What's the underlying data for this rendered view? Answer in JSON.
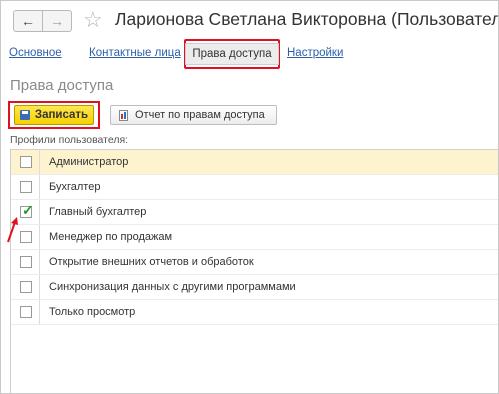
{
  "window": {
    "title": "Ларионова Светлана Викторовна (Пользователь)"
  },
  "nav": {
    "back_icon": "arrow-left-icon",
    "forward_icon": "arrow-right-icon",
    "favorite_icon": "star-icon"
  },
  "tabs": [
    {
      "label": "Основное"
    },
    {
      "label": "Контактные лица"
    },
    {
      "label": "Права доступа",
      "active": true
    },
    {
      "label": "Настройки"
    }
  ],
  "section_title": "Права доступа",
  "toolbar": {
    "save_label": "Записать",
    "report_label": "Отчет по правам доступа"
  },
  "profiles_label": "Профили пользователя:",
  "profiles": [
    {
      "label": "Администратор",
      "checked": false,
      "selected": true
    },
    {
      "label": "Бухгалтер",
      "checked": false
    },
    {
      "label": "Главный бухгалтер",
      "checked": true
    },
    {
      "label": "Менеджер по продажам",
      "checked": false
    },
    {
      "label": "Открытие внешних отчетов и обработок",
      "checked": false
    },
    {
      "label": "Синхронизация данных с другими программами",
      "checked": false
    },
    {
      "label": "Только просмотр",
      "checked": false
    }
  ],
  "colors": {
    "highlight": "#e01020",
    "save_button": "#f5d000",
    "selected_row": "#fdf3cf",
    "link": "#2d5fa8"
  }
}
